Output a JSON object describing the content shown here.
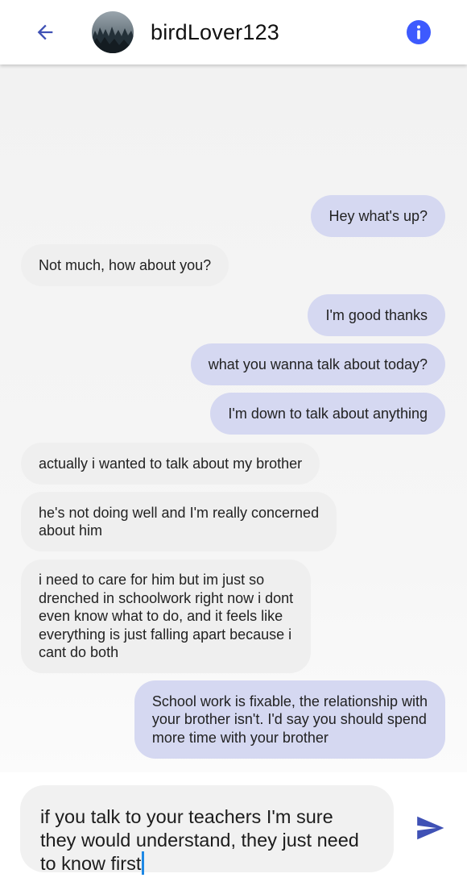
{
  "header": {
    "username": "birdLover123",
    "back_icon": "arrow-back-icon",
    "info_icon": "info-icon"
  },
  "messages": [
    {
      "from": "me",
      "text": "Hey what's up?"
    },
    {
      "from": "them",
      "text": "Not much, how about you?"
    },
    {
      "from": "me",
      "text": "I'm good thanks"
    },
    {
      "from": "me",
      "text": "what you wanna talk about today?"
    },
    {
      "from": "me",
      "text": "I'm down to talk about anything"
    },
    {
      "from": "them",
      "text": "actually i wanted to talk about my brother"
    },
    {
      "from": "them",
      "text": "he's not doing well and I'm really concerned\nabout him"
    },
    {
      "from": "them",
      "text": "i need to care for him but im just so\ndrenched in schoolwork right now i dont\neven know what to do, and it feels like\neverything is just falling apart because i\ncant do both"
    },
    {
      "from": "me",
      "text": "School work is fixable, the relationship with\nyour brother isn't. I'd say you should spend\nmore time with your brother"
    }
  ],
  "composer": {
    "value": "if you talk to your teachers I'm sure\nthey would understand, they just need\nto know first",
    "send_icon": "send-icon"
  },
  "colors": {
    "accent": "#3f51b5",
    "outgoing_bubble": "#d5d8f1",
    "incoming_bubble": "#efefef",
    "info": "#3d5afe"
  }
}
